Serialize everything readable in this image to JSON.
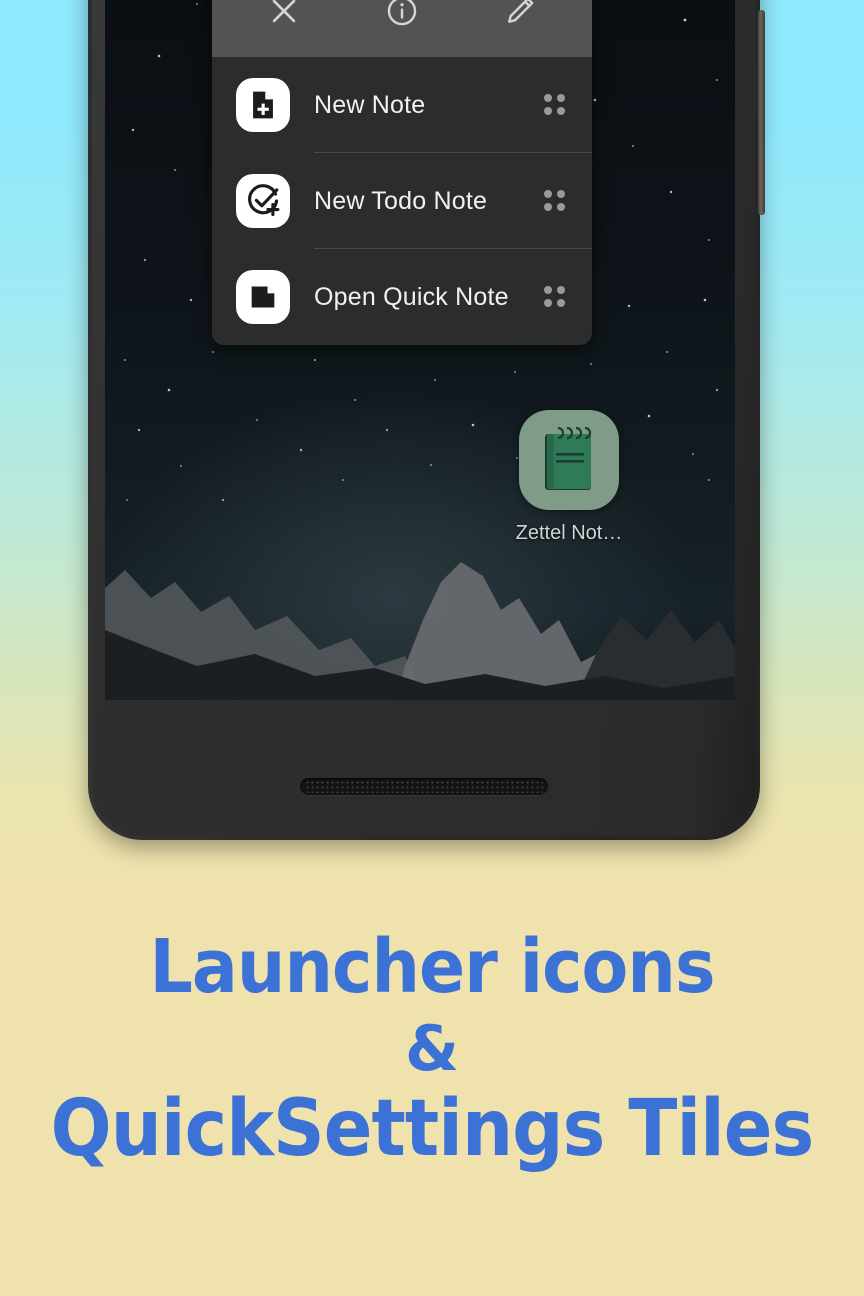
{
  "background": {
    "gradient_top": "#8FE9FC",
    "gradient_bottom": "#F0E2AD"
  },
  "phone": {
    "device_name": "android-phone-mockup",
    "body_color": "#2c2c2c",
    "buttons": [
      {
        "name": "power-button"
      }
    ],
    "speaker": "bottom-speaker-grille"
  },
  "popup": {
    "panel_color": "#2c2c2c",
    "toolbar_color": "#535353",
    "toolbar": [
      {
        "name": "close-icon",
        "label": "Close",
        "glyph": "x"
      },
      {
        "name": "info-icon",
        "label": "App info",
        "glyph": "info-circle"
      },
      {
        "name": "edit-icon",
        "label": "Edit",
        "glyph": "pencil"
      }
    ],
    "items": [
      {
        "label": "New Note",
        "icon": "note-add-icon",
        "handle": "drag-handle-icon"
      },
      {
        "label": "New Todo Note",
        "icon": "check-circle-add-icon",
        "handle": "drag-handle-icon"
      },
      {
        "label": "Open Quick Note",
        "icon": "quick-note-icon",
        "handle": "drag-handle-icon"
      }
    ]
  },
  "home_screen": {
    "app": {
      "label": "Zettel Not…",
      "icon": "notepad-icon",
      "tile_color": "#7f9c88",
      "notepad_color": "#2f6f52"
    },
    "wallpaper": "night-sky-mountains"
  },
  "caption": {
    "color": "#3C72D6",
    "line1": "Launcher icons",
    "line2": "&",
    "line3": "QuickSettings Tiles"
  }
}
